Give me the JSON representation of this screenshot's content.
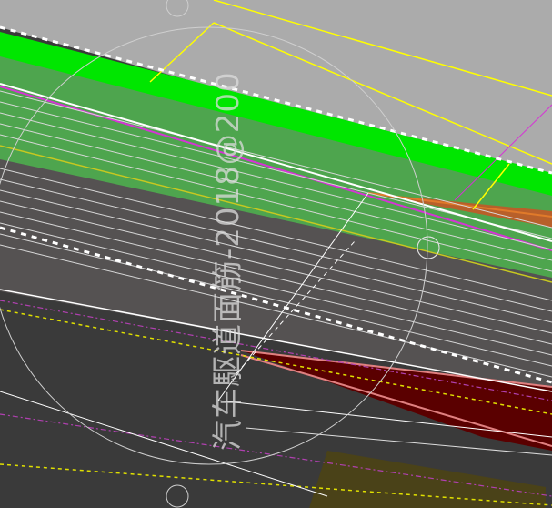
{
  "app": {
    "view": "cad-road-design-viewport"
  },
  "watermark": {
    "text": "汽车駆道面筋-2018@200"
  },
  "colors": {
    "background_gray": "#ababab",
    "dark_asphalt": "#3a3a3a",
    "mid_asphalt": "#545252",
    "green_bright": "#00e600",
    "green_fill": "#4ea54e",
    "magenta": "#d633d6",
    "yellow": "#ffff00",
    "white": "#ffffff",
    "dark_red": "#5a0000",
    "orange": "#e07a2a",
    "olive": "#4a4218"
  },
  "icons": {
    "crosshair": "crosshair-circle-icon",
    "snap_circle": "snap-circle-icon"
  }
}
